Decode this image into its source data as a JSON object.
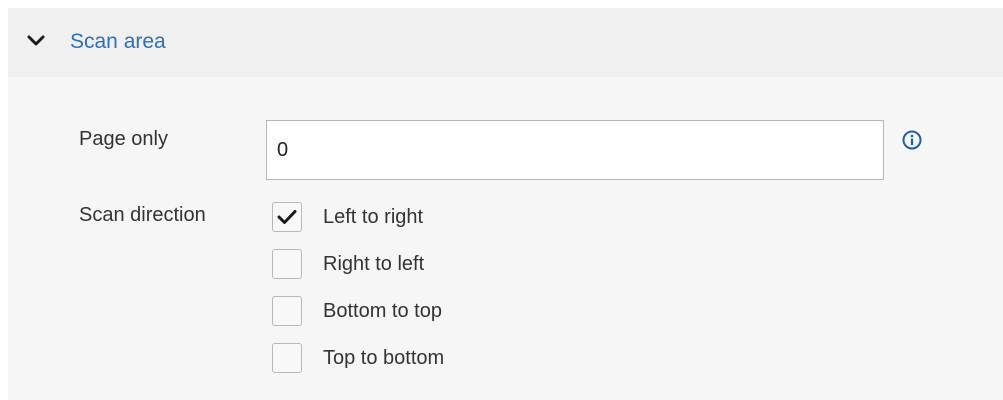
{
  "section": {
    "title": "Scan area",
    "expanded": true
  },
  "page_only": {
    "label": "Page only",
    "value": "0"
  },
  "scan_direction": {
    "label": "Scan direction",
    "options": [
      {
        "label": "Left to right",
        "checked": true
      },
      {
        "label": "Right to left",
        "checked": false
      },
      {
        "label": "Bottom to top",
        "checked": false
      },
      {
        "label": "Top to bottom",
        "checked": false
      }
    ]
  },
  "icons": {
    "collapse": "chevron-down-icon",
    "info": "info-icon",
    "check": "checkmark-icon"
  },
  "colors": {
    "accent": "#2d6fb8",
    "header_bg": "#f0f0f0",
    "body_bg": "#f6f6f6"
  }
}
